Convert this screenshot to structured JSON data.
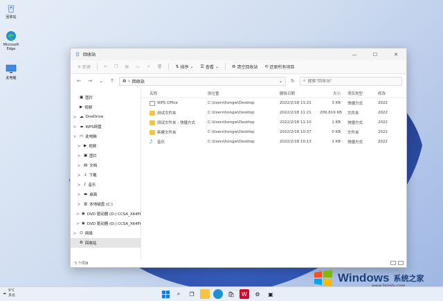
{
  "desktop": {
    "icons": [
      {
        "label": "回收站",
        "icon": "recycle-bin-icon"
      },
      {
        "label": "Microsoft Edge",
        "icon": "edge-icon"
      },
      {
        "label": "此电脑",
        "icon": "monitor-icon"
      }
    ]
  },
  "window": {
    "title": "回收站",
    "controls": {
      "minimize": "—",
      "maximize": "☐",
      "close": "✕"
    },
    "toolbar": {
      "new_label": "新建",
      "sort_label": "排序",
      "view_label": "查看",
      "empty_bin_label": "清空回收站",
      "restore_all_label": "还原所有项目"
    },
    "address": {
      "path": "回收站",
      "search_placeholder": "搜索\"回收站\""
    },
    "nav": [
      {
        "label": "图片",
        "icon": "pictures-icon",
        "chev": ""
      },
      {
        "label": "视频",
        "icon": "video-icon",
        "chev": ""
      },
      {
        "label": "OneDrive",
        "icon": "cloud-icon",
        "chev": ">"
      },
      {
        "label": "WPS网盘",
        "icon": "cloud-icon",
        "chev": ">"
      },
      {
        "label": "此电脑",
        "icon": "monitor-icon",
        "chev": "v"
      },
      {
        "label": "视频",
        "icon": "video-icon",
        "chev": ">"
      },
      {
        "label": "图片",
        "icon": "pictures-icon",
        "chev": ">"
      },
      {
        "label": "文档",
        "icon": "document-icon",
        "chev": ">"
      },
      {
        "label": "下载",
        "icon": "download-icon",
        "chev": ">"
      },
      {
        "label": "音乐",
        "icon": "music-icon",
        "chev": ">"
      },
      {
        "label": "桌面",
        "icon": "desktop-icon",
        "chev": ">"
      },
      {
        "label": "本地磁盘 (C:)",
        "icon": "drive-icon",
        "chev": ">"
      },
      {
        "label": "DVD 驱动器 (D:) CCSA_X64FRE",
        "icon": "dvd-icon",
        "chev": ">"
      },
      {
        "label": "DVD 驱动器 (D:) CCSA_X64FRE_",
        "icon": "dvd-icon",
        "chev": ">"
      },
      {
        "label": "网络",
        "icon": "network-icon",
        "chev": ">"
      },
      {
        "label": "回收站",
        "icon": "recycle-bin-icon",
        "chev": ""
      }
    ],
    "columns": {
      "name": "名称",
      "location": "原位置",
      "deleted": "删除日期",
      "size": "大小",
      "type": "项目类型",
      "modified": "修改"
    },
    "rows": [
      {
        "name": "WPS Office",
        "location": "C:\\Users\\hongw\\Desktop",
        "deleted": "2022/2/18 11:21",
        "size": "3 KB",
        "type": "快捷方式",
        "modified": "2022",
        "icon": "wps-icon"
      },
      {
        "name": "测试文件夹",
        "location": "C:\\Users\\hongw\\Desktop",
        "deleted": "2022/2/18 11:21",
        "size": "209,819 KB",
        "type": "文件夹",
        "modified": "2022",
        "icon": "folder-icon"
      },
      {
        "name": "测试文件夹 - 快捷方式",
        "location": "C:\\Users\\hongw\\Desktop",
        "deleted": "2022/2/18 11:10",
        "size": "1 KB",
        "type": "快捷方式",
        "modified": "2022",
        "icon": "folder-shortcut-icon"
      },
      {
        "name": "新建文件夹",
        "location": "C:\\Users\\hongw\\Desktop",
        "deleted": "2022/2/18 10:37",
        "size": "0 KB",
        "type": "文件夹",
        "modified": "2022",
        "icon": "folder-icon"
      },
      {
        "name": "音乐",
        "location": "C:\\Users\\hongw\\Desktop",
        "deleted": "2022/2/18 10:13",
        "size": "1 KB",
        "type": "快捷方式",
        "modified": "2022",
        "icon": "music-shortcut-icon"
      }
    ],
    "status": "5 个项目"
  },
  "taskbar": {
    "weather_temp": "9°C",
    "weather_desc": "多云"
  },
  "watermark": {
    "brand": "Windows",
    "cn": "系统之家",
    "url": "www.bjjmlv.com"
  }
}
